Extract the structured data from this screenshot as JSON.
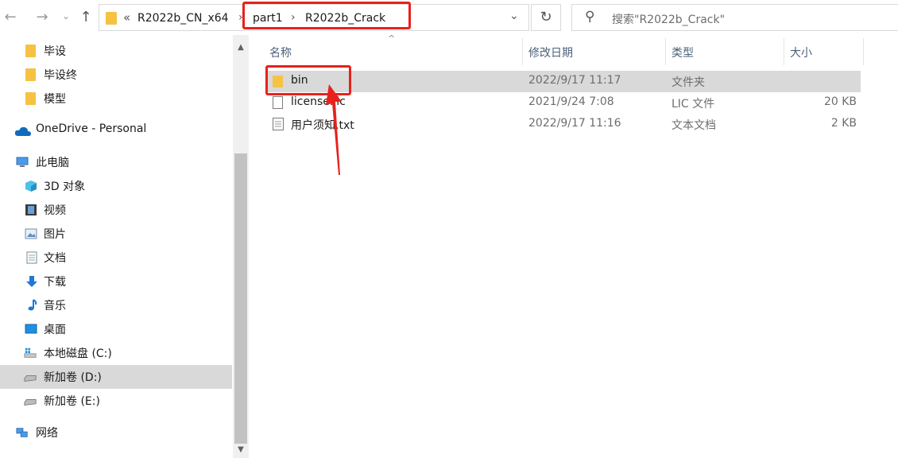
{
  "toolbar": {
    "back": "←",
    "forward": "→",
    "dropdown": "⌄",
    "up": "↑",
    "refresh": "↻"
  },
  "address": {
    "overflow": "«",
    "crumbs": [
      "R2022b_CN_x64",
      "part1",
      "R2022b_Crack"
    ],
    "separator": "›",
    "dropdown": "⌄"
  },
  "search": {
    "icon": "⚲",
    "placeholder": "搜索\"R2022b_Crack\""
  },
  "sidebar": {
    "items": [
      {
        "label": "毕设",
        "icon": "folder-icon"
      },
      {
        "label": "毕设终",
        "icon": "folder-icon"
      },
      {
        "label": "模型",
        "icon": "folder-icon"
      },
      {
        "label": "OneDrive - Personal",
        "icon": "cloud-icon"
      },
      {
        "label": "此电脑",
        "icon": "computer-icon"
      },
      {
        "label": "3D 对象",
        "icon": "cube-icon"
      },
      {
        "label": "视频",
        "icon": "video-icon"
      },
      {
        "label": "图片",
        "icon": "picture-icon"
      },
      {
        "label": "文档",
        "icon": "document-icon"
      },
      {
        "label": "下载",
        "icon": "download-icon"
      },
      {
        "label": "音乐",
        "icon": "music-icon"
      },
      {
        "label": "桌面",
        "icon": "desktop-icon"
      },
      {
        "label": "本地磁盘 (C:)",
        "icon": "drive-c-icon"
      },
      {
        "label": "新加卷 (D:)",
        "icon": "drive-icon",
        "selected": true
      },
      {
        "label": "新加卷 (E:)",
        "icon": "drive-icon"
      },
      {
        "label": "网络",
        "icon": "network-icon"
      }
    ]
  },
  "columns": {
    "name": "名称",
    "date": "修改日期",
    "type": "类型",
    "size": "大小",
    "sort_indicator": "^"
  },
  "files": [
    {
      "name": "bin",
      "date": "2022/9/17 11:17",
      "type": "文件夹",
      "size": "",
      "icon": "folder-icon",
      "selected": true
    },
    {
      "name": "license.lic",
      "date": "2021/9/24 7:08",
      "type": "LIC 文件",
      "size": "20 KB",
      "icon": "file-icon"
    },
    {
      "name": "用户须知.txt",
      "date": "2022/9/17 11:16",
      "type": "文本文档",
      "size": "2 KB",
      "icon": "text-file-icon"
    }
  ],
  "colors": {
    "highlight_red": "#e8211c",
    "selection_gray": "#d9d9d9",
    "folder_yellow": "#f5c243"
  }
}
